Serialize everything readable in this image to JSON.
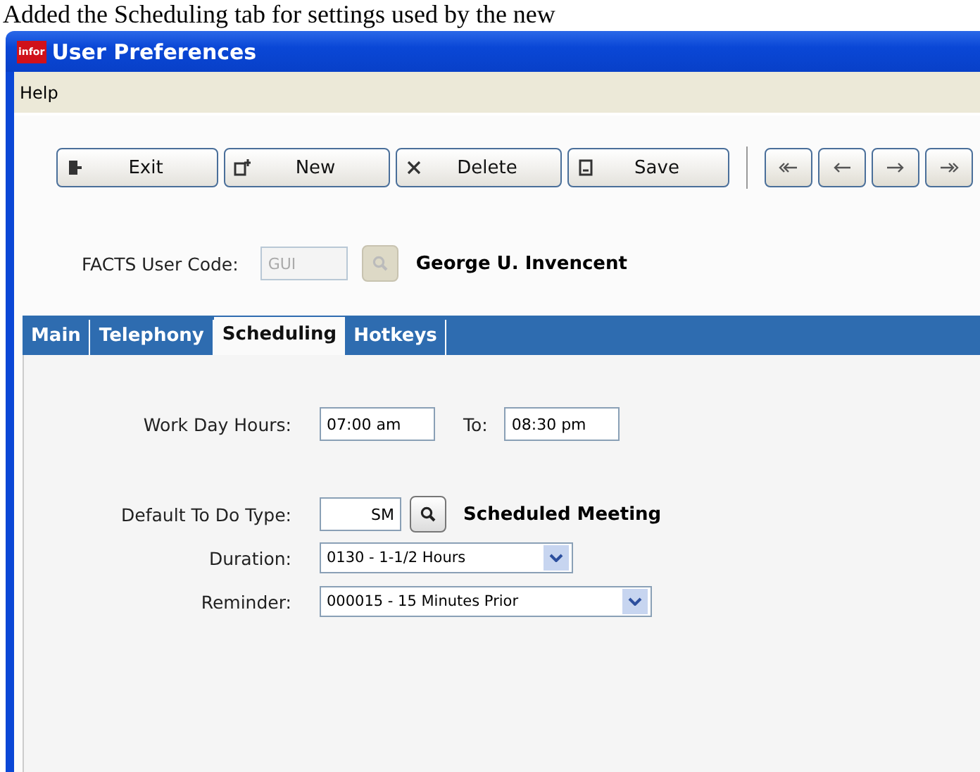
{
  "caption": "Added the Scheduling tab for settings used by the new",
  "window": {
    "title": "User Preferences",
    "logo": "infor"
  },
  "menu": [
    "Help"
  ],
  "toolbar": [
    {
      "label": "Exit",
      "kind": "exit"
    },
    {
      "label": "New",
      "kind": "new"
    },
    {
      "label": "Delete",
      "kind": "delete"
    },
    {
      "label": "Save",
      "kind": "save"
    }
  ],
  "nav_buttons": [
    {
      "kind": "first"
    },
    {
      "kind": "prev"
    },
    {
      "kind": "next"
    },
    {
      "kind": "last"
    }
  ],
  "user_code": {
    "label": "FACTS User Code:",
    "value": "GUI",
    "disabled": true,
    "name": "George U. Invencent"
  },
  "tabs": [
    {
      "label": "Main",
      "selected": false
    },
    {
      "label": "Telephony",
      "selected": false
    },
    {
      "label": "Scheduling",
      "selected": true
    },
    {
      "label": "Hotkeys",
      "selected": false
    }
  ],
  "work_day": {
    "label": "Work Day Hours:",
    "from": "07:00 am",
    "to_label": "To:",
    "to": "08:30 pm"
  },
  "todo_type": {
    "label": "Default To Do Type:",
    "value": "SM",
    "description": "Scheduled Meeting"
  },
  "duration": {
    "label": "Duration:",
    "value": "0130 - 1-1/2 Hours"
  },
  "reminder": {
    "label": "Reminder:",
    "value": "000015 - 15 Minutes Prior"
  }
}
